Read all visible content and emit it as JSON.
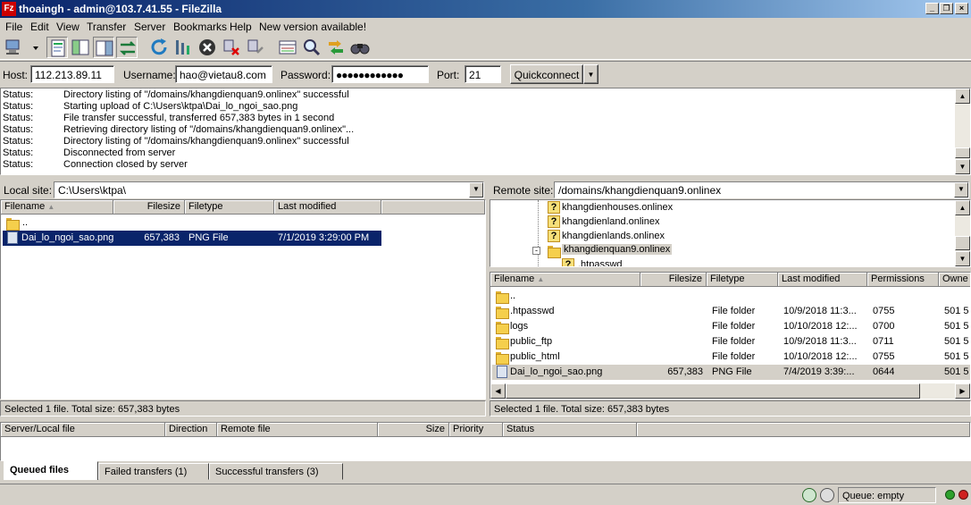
{
  "window": {
    "title": "thoaingh - admin@103.7.41.55 - FileZilla",
    "app_icon": "Fz"
  },
  "menu": [
    "File",
    "Edit",
    "View",
    "Transfer",
    "Server",
    "Bookmarks",
    "Help",
    "New version available!"
  ],
  "quickconnect": {
    "host_label": "Host:",
    "host_value": "112.213.89.11",
    "user_label": "Username:",
    "user_value": "hao@vietau8.com",
    "pass_label": "Password:",
    "pass_value": "●●●●●●●●●●●●",
    "port_label": "Port:",
    "port_value": "21",
    "button": "Quickconnect"
  },
  "log": [
    {
      "k": "Status:",
      "v": "Directory listing of \"/domains/khangdienquan9.onlinex\" successful"
    },
    {
      "k": "Status:",
      "v": "Starting upload of C:\\Users\\ktpa\\Dai_lo_ngoi_sao.png"
    },
    {
      "k": "Status:",
      "v": "File transfer successful, transferred 657,383 bytes in 1 second"
    },
    {
      "k": "Status:",
      "v": "Retrieving directory listing of \"/domains/khangdienquan9.onlinex\"..."
    },
    {
      "k": "Status:",
      "v": "Directory listing of \"/domains/khangdienquan9.onlinex\" successful"
    },
    {
      "k": "Status:",
      "v": "Disconnected from server"
    },
    {
      "k": "Status:",
      "v": "Connection closed by server"
    }
  ],
  "local": {
    "site_label": "Local site:",
    "site_path": "C:\\Users\\ktpa\\",
    "headers": {
      "filename": "Filename",
      "filesize": "Filesize",
      "filetype": "Filetype",
      "modified": "Last modified"
    },
    "files": [
      {
        "name": "..",
        "size": "",
        "type": "",
        "modified": "",
        "kind": "folder"
      },
      {
        "name": "Dai_lo_ngoi_sao.png",
        "size": "657,383",
        "type": "PNG File",
        "modified": "7/1/2019 3:29:00 PM",
        "kind": "file"
      }
    ],
    "status": "Selected 1 file. Total size: 657,383 bytes"
  },
  "remote": {
    "site_label": "Remote site:",
    "site_path": "/domains/khangdienquan9.onlinex",
    "tree": [
      "khangdienhouses.onlinex",
      "khangdienland.onlinex",
      "khangdienlands.onlinex",
      "khangdienquan9.onlinex",
      ".htpasswd"
    ],
    "headers": {
      "filename": "Filename",
      "filesize": "Filesize",
      "filetype": "Filetype",
      "modified": "Last modified",
      "permissions": "Permissions",
      "owner": "Owne"
    },
    "files": [
      {
        "name": "..",
        "size": "",
        "type": "",
        "modified": "",
        "perm": "",
        "owner": "",
        "kind": "folder"
      },
      {
        "name": ".htpasswd",
        "size": "",
        "type": "File folder",
        "modified": "10/9/2018 11:3...",
        "perm": "0755",
        "owner": "501 5",
        "kind": "folder"
      },
      {
        "name": "logs",
        "size": "",
        "type": "File folder",
        "modified": "10/10/2018 12:...",
        "perm": "0700",
        "owner": "501 5",
        "kind": "folder"
      },
      {
        "name": "public_ftp",
        "size": "",
        "type": "File folder",
        "modified": "10/9/2018 11:3...",
        "perm": "0711",
        "owner": "501 5",
        "kind": "folder"
      },
      {
        "name": "public_html",
        "size": "",
        "type": "File folder",
        "modified": "10/10/2018 12:...",
        "perm": "0755",
        "owner": "501 5",
        "kind": "folder"
      },
      {
        "name": "Dai_lo_ngoi_sao.png",
        "size": "657,383",
        "type": "PNG File",
        "modified": "7/4/2019 3:39:...",
        "perm": "0644",
        "owner": "501 5",
        "kind": "file"
      }
    ],
    "status": "Selected 1 file. Total size: 657,383 bytes"
  },
  "queue": {
    "headers": {
      "server": "Server/Local file",
      "direction": "Direction",
      "remote": "Remote file",
      "size": "Size",
      "priority": "Priority",
      "status": "Status"
    },
    "tabs": [
      "Queued files",
      "Failed transfers (1)",
      "Successful transfers (3)"
    ],
    "status": "Queue: empty"
  },
  "colors": {
    "selection": "#0a246a",
    "chrome": "#d4d0c8",
    "led_green": "#2da02d",
    "led_red": "#d02020"
  }
}
